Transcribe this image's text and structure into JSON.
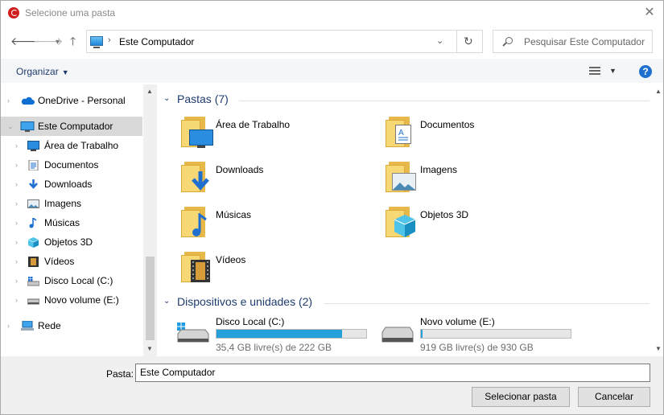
{
  "window": {
    "title": "Selecione uma pasta"
  },
  "nav": {
    "address_path": "Este Computador",
    "search_placeholder": "Pesquisar Este Computador"
  },
  "toolbar": {
    "organize_label": "Organizar"
  },
  "sidebar": {
    "items": [
      {
        "label": "OneDrive - Personal",
        "icon": "onedrive-icon"
      },
      {
        "label": "Este Computador",
        "icon": "computer-icon",
        "selected": true
      },
      {
        "label": "Área de Trabalho",
        "icon": "desktop-icon"
      },
      {
        "label": "Documentos",
        "icon": "documents-icon"
      },
      {
        "label": "Downloads",
        "icon": "downloads-icon"
      },
      {
        "label": "Imagens",
        "icon": "pictures-icon"
      },
      {
        "label": "Músicas",
        "icon": "music-icon"
      },
      {
        "label": "Objetos 3D",
        "icon": "objects-3d-icon"
      },
      {
        "label": "Vídeos",
        "icon": "videos-icon"
      },
      {
        "label": "Disco Local (C:)",
        "icon": "drive-icon"
      },
      {
        "label": "Novo volume (E:)",
        "icon": "drive-icon"
      },
      {
        "label": "Rede",
        "icon": "network-icon"
      }
    ]
  },
  "main": {
    "folders_header": "Pastas (7)",
    "folders": [
      {
        "label": "Área de Trabalho",
        "icon": "desktop-folder-icon"
      },
      {
        "label": "Documentos",
        "icon": "documents-folder-icon"
      },
      {
        "label": "Downloads",
        "icon": "downloads-folder-icon"
      },
      {
        "label": "Imagens",
        "icon": "pictures-folder-icon"
      },
      {
        "label": "Músicas",
        "icon": "music-folder-icon"
      },
      {
        "label": "Objetos 3D",
        "icon": "objects-3d-folder-icon"
      },
      {
        "label": "Vídeos",
        "icon": "videos-folder-icon"
      }
    ],
    "drives_header": "Dispositivos e unidades (2)",
    "drives": [
      {
        "label": "Disco Local (C:)",
        "free": "35,4 GB livre(s) de 222 GB",
        "used_fraction": 0.84,
        "icon": "windows-drive-icon"
      },
      {
        "label": "Novo volume (E:)",
        "free": "919 GB livre(s) de 930 GB",
        "used_fraction": 0.01,
        "icon": "drive-icon"
      }
    ]
  },
  "footer": {
    "folder_label": "Pasta:",
    "folder_value": "Este Computador",
    "select_button": "Selecionar pasta",
    "cancel_button": "Cancelar"
  },
  "colors": {
    "accent": "#1e3c6e",
    "drive_bar": "#26a0da",
    "selected": "#d9d9d9",
    "help": "#1f6fd0"
  }
}
